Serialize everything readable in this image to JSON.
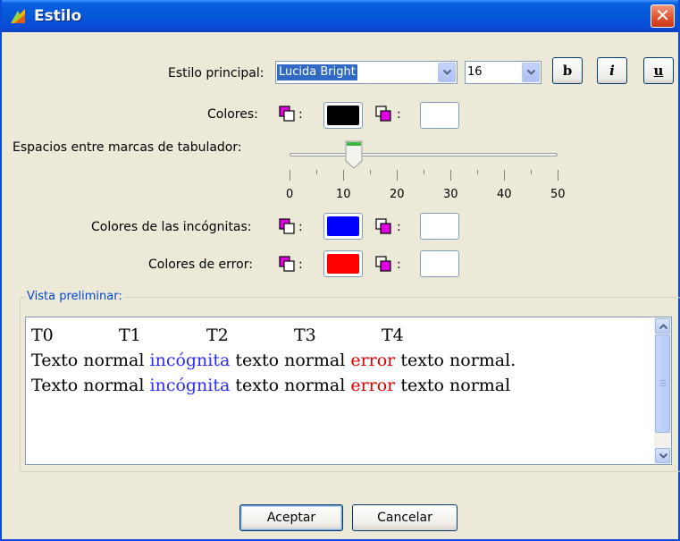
{
  "window": {
    "title": "Estilo",
    "close_glyph": "✕",
    "app_icon": "geogebra-style-icon"
  },
  "main_style": {
    "label": "Estilo principal:",
    "font": "Lucida Bright",
    "size": "16",
    "bold_label": "b",
    "italic_label": "i",
    "underline_label": "u"
  },
  "colors": {
    "label": "Colores:",
    "foreground": "#000000",
    "background": "#FFFFFF",
    "separator": ":"
  },
  "tab_spacing": {
    "label": "Espacios entre marcas de tabulador:",
    "value": 12,
    "min": 0,
    "max": 50,
    "tick_labels": [
      "0",
      "10",
      "20",
      "30",
      "40",
      "50"
    ]
  },
  "unknown_colors": {
    "label": "Colores de las incógnitas:",
    "foreground": "#0000FF",
    "background": "#FFFFFF"
  },
  "error_colors": {
    "label": "Colores de error:",
    "foreground": "#FF0000",
    "background": "#FFFFFF"
  },
  "preview": {
    "title": "Vista preliminar:",
    "tabs": [
      "T0",
      "T1",
      "T2",
      "T3",
      "T4"
    ],
    "normal": "Texto normal",
    "unknown": "incógnita",
    "normal2": "texto normal",
    "error": "error",
    "normal3": "texto",
    "normal4": "normal.",
    "normal5": "normal"
  },
  "buttons": {
    "accept": "Aceptar",
    "cancel": "Cancelar"
  }
}
